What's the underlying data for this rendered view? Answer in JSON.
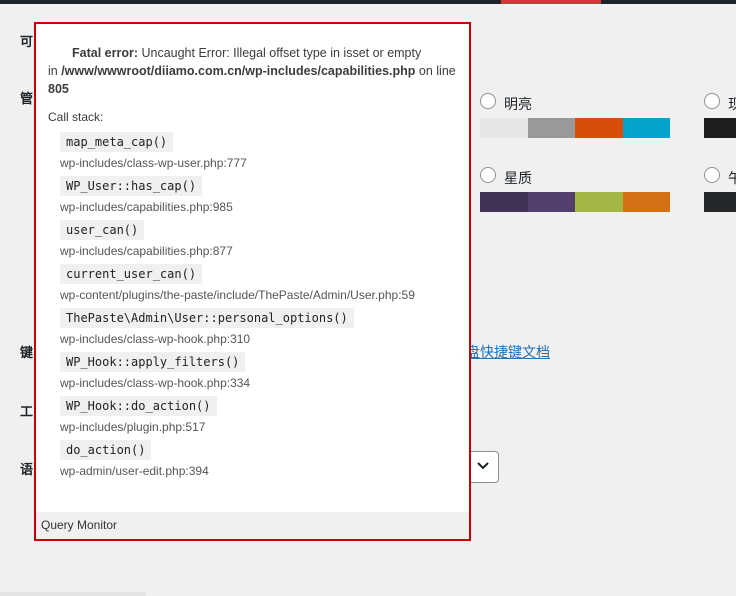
{
  "admin_bar": {
    "accent_color": "#d63638"
  },
  "background": {
    "left_labels": [
      "可",
      "管",
      "键",
      "工",
      "语"
    ],
    "color_schemes": [
      {
        "name": "明亮",
        "colors": [
          "#e5e5e5",
          "#999999",
          "#d64e07",
          "#04a4cc"
        ]
      },
      {
        "name": "现",
        "colors": [
          "#1e1e1e"
        ]
      },
      {
        "name": "星质",
        "colors": [
          "#413256",
          "#523f6d",
          "#a3b745",
          "#d46f15"
        ]
      },
      {
        "name": "午",
        "colors": [
          "#25282b"
        ]
      }
    ],
    "shortcuts_link": "盘快捷键文档"
  },
  "qm": {
    "error_label": "Fatal error:",
    "error_message": " Uncaught Error: Illegal offset type in isset or empty",
    "in_label": "in ",
    "error_file": "/www/wwwroot/diiamo.com.cn/wp-includes/capabilities.php",
    "on_line_label": " on line ",
    "line_number": "805",
    "callstack_title": "Call stack:",
    "frames": [
      {
        "func": "map_meta_cap()",
        "file": "wp-includes/class-wp-user.php:777"
      },
      {
        "func": "WP_User::has_cap()",
        "file": "wp-includes/capabilities.php:985"
      },
      {
        "func": "user_can()",
        "file": "wp-includes/capabilities.php:877"
      },
      {
        "func": "current_user_can()",
        "file": "wp-content/plugins/the-paste/include/ThePaste/Admin/User.php:59"
      },
      {
        "func": "ThePaste\\Admin\\User::personal_options()",
        "file": "wp-includes/class-wp-hook.php:310"
      },
      {
        "func": "WP_Hook::apply_filters()",
        "file": "wp-includes/class-wp-hook.php:334"
      },
      {
        "func": "WP_Hook::do_action()",
        "file": "wp-includes/plugin.php:517"
      },
      {
        "func": "do_action()",
        "file": "wp-admin/user-edit.php:394"
      }
    ],
    "footer": "Query Monitor"
  }
}
